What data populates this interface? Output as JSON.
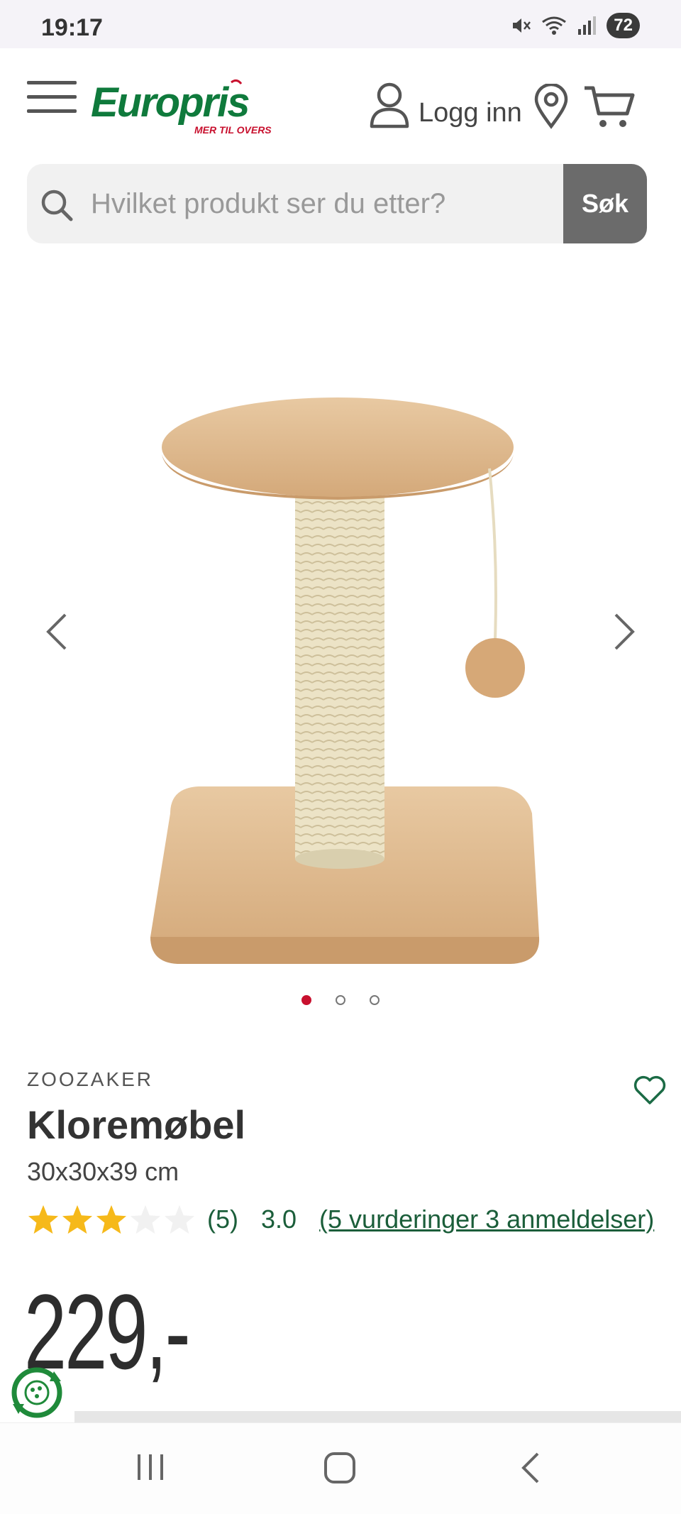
{
  "status_bar": {
    "time": "19:17",
    "battery": "72"
  },
  "header": {
    "logo_text": "Europris",
    "logo_tagline": "MER TIL OVERS",
    "login_label": "Logg inn"
  },
  "search": {
    "placeholder": "Hvilket produkt ser du etter?",
    "button_label": "Søk"
  },
  "carousel": {
    "image_count": 3,
    "active_index": 0
  },
  "product": {
    "brand": "ZOOZAKER",
    "title": "Kloremøbel",
    "subtitle": "30x30x39 cm",
    "rating": 3,
    "rating_max": 5,
    "rating_count": "(5)",
    "rating_value": "3.0",
    "reviews_link": "(5 vurderinger 3 anmeldelser)",
    "price": "229,-"
  },
  "colors": {
    "brand_green": "#0f7a3c",
    "brand_red": "#c8102e",
    "star_gold": "#f6b91a",
    "link_green": "#1b5e3a"
  }
}
